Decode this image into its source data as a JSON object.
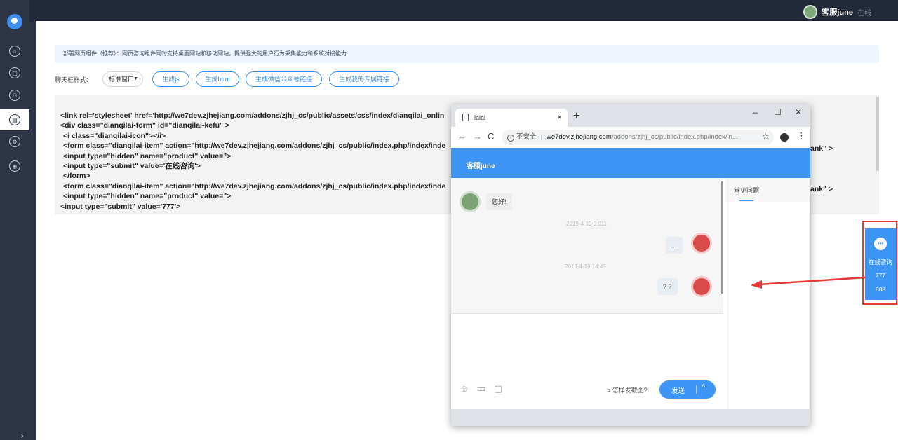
{
  "topbar": {
    "agent_name": "客服june",
    "agent_status": "在线"
  },
  "sidebar": {
    "items": [
      {
        "icon": "home-icon"
      },
      {
        "icon": "chat-icon"
      },
      {
        "icon": "users-icon"
      },
      {
        "icon": "embed-icon",
        "active": true
      },
      {
        "icon": "settings-icon"
      },
      {
        "icon": "account-icon"
      }
    ]
  },
  "main": {
    "notice": "部署网页组件（推荐）：网页咨询组件同时支持桌面网站和移动网站，提供强大的用户行为采集能力和系统对接能力",
    "style_label": "聊天框样式:",
    "style_value": "标准窗口",
    "buttons": [
      "生成js",
      "生成html",
      "生成微信公众号链接",
      "生成我的专属链接"
    ],
    "code_lines": [
      "<link rel='stylesheet' href='http://we7dev.zjhejiang.com/addons/zjhj_cs/public/assets/css/index/dianqilai_onlin",
      "<div class=\"dianqilai-form\" id=\"dianqilai-kefu\" >",
      "  <i class=\"dianqilai-icon\"></i>",
      "  <form class=\"dianqilai-item\" action=\"http://we7dev.zjhejiang.com/addons/zjhj_cs/public/index.php/index/inde",
      "  <input type=\"hidden\" name=\"product\" value=\">",
      "  <input type=\"submit\" value='在线咨询'>",
      "  </form>",
      "  <form class=\"dianqilai-item\" action=\"http://we7dev.zjhejiang.com/addons/zjhj_cs/public/index.php/index/inde",
      "  <input type=\"hidden\" name=\"product\" value=\">",
      "<input type=\"submit\" value='777'>"
    ],
    "code_overflow": [
      "ank\" >",
      "ank\" >"
    ]
  },
  "browser": {
    "tab_title": "lalal",
    "tab_close": "×",
    "new_tab": "+",
    "window_controls": [
      "–",
      "☐",
      "✕"
    ],
    "nav": {
      "back": "←",
      "forward": "→",
      "reload": "C"
    },
    "insecure_label": "不安全",
    "url_host": "we7dev.zjhejiang.com",
    "url_path": "/addons/zjhj_cs/public/index.php/index/in...",
    "star": "☆",
    "menu": "⋮"
  },
  "chat": {
    "header_name": "客服june",
    "messages": [
      {
        "from": "agent",
        "text": "您好!"
      },
      {
        "time": "2019-4-19 9:011"
      },
      {
        "from": "user",
        "text": "..."
      },
      {
        "time": "2019-4-19 14:45"
      },
      {
        "from": "user",
        "text": "? ?"
      }
    ],
    "screenshot_hint": "怎样发截图?",
    "send_label": "发送",
    "faq_tab": "常见问题"
  },
  "float_widget": {
    "label": "在线咨询",
    "items": [
      "777",
      "888"
    ]
  },
  "colors": {
    "accent": "#3d96f5",
    "topbar": "#222a3a",
    "sidebar": "#2c3446",
    "highlight": "#e53935"
  }
}
